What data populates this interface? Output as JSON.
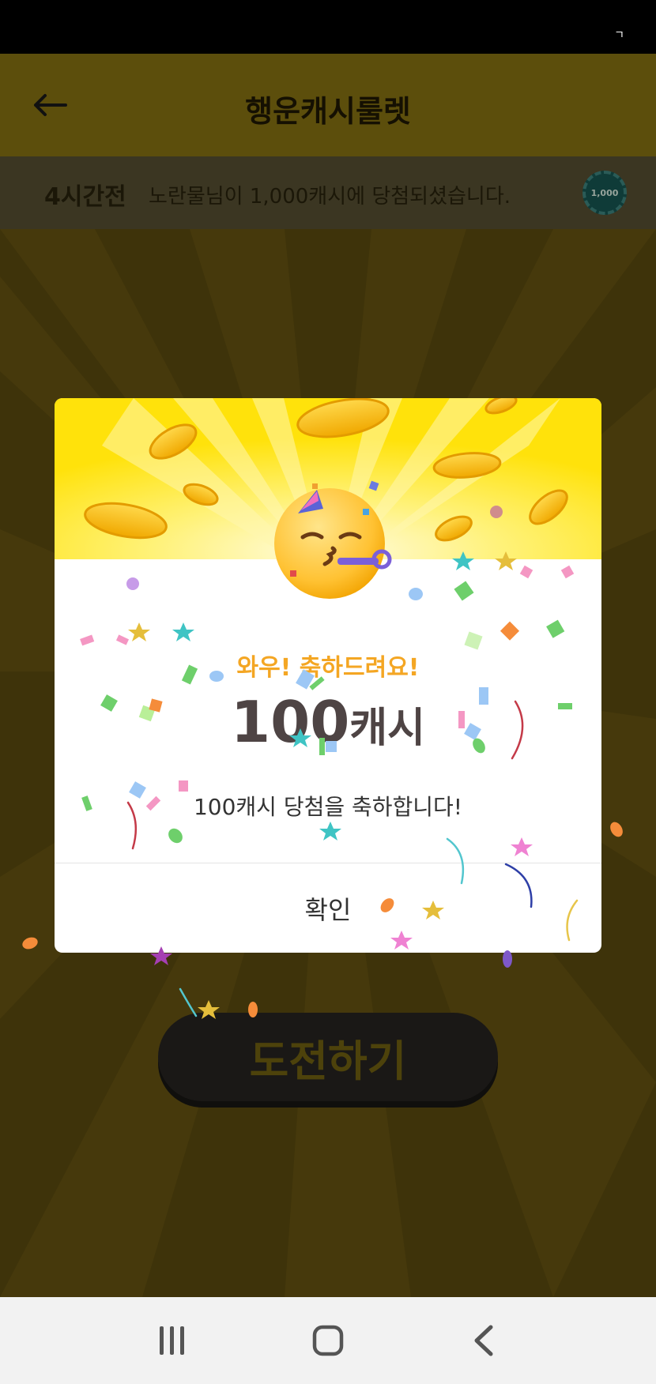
{
  "status_bar": {
    "indicator": "ㄱ"
  },
  "header": {
    "title": "행운캐시룰렛"
  },
  "ticker": {
    "time": "4시간전",
    "message": "노란물님이 1,000캐시에 당첨되셨습니다.",
    "coin_label": "1,000"
  },
  "main": {
    "challenge_label": "도전하기"
  },
  "dialog": {
    "congrats": "와우! 축하드려요!",
    "amount_number": "100",
    "amount_unit": "캐시",
    "description": "100캐시 당첨을 축하합니다!",
    "confirm_label": "확인"
  },
  "colors": {
    "modal_top": "#ffe20b",
    "congrats_text": "#f4a623",
    "dim_header": "#5c4e0c",
    "dim_main": "#3e330a"
  },
  "icons": {
    "back": "arrow-left-icon",
    "emoji": "party-face-icon",
    "nav_recent": "recent-apps-icon",
    "nav_home": "home-icon",
    "nav_back": "back-chevron-icon"
  }
}
